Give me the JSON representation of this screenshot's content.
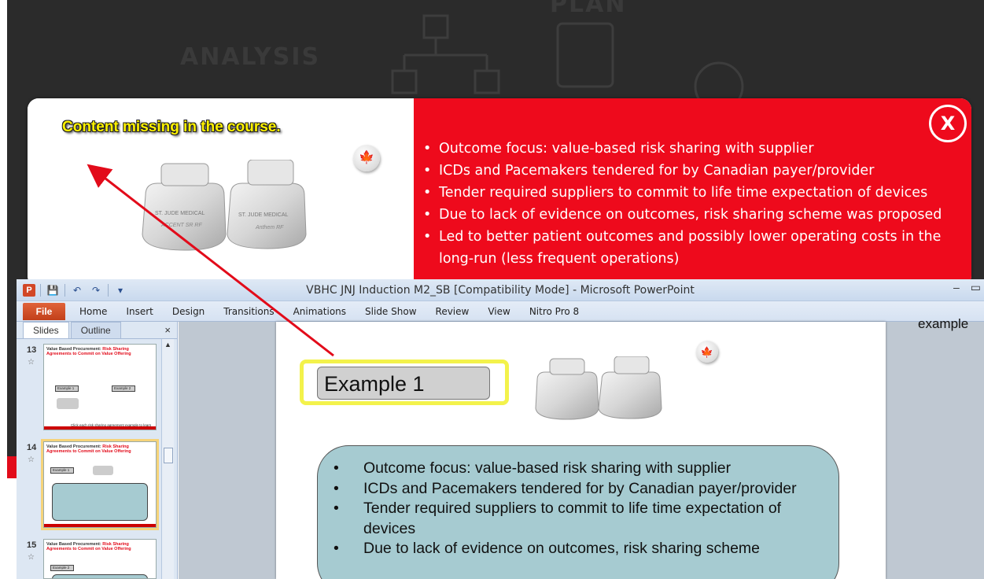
{
  "course": {
    "ghost_words": [
      "ANALYSIS",
      "PLAN"
    ],
    "popup": {
      "annotation_note": "Content missing in the course.",
      "bullets": [
        "Outcome focus: value-based risk sharing with supplier",
        "ICDs and Pacemakers tendered for by Canadian payer/provider",
        "Tender required suppliers to commit to life time expectation of devices",
        "Due to lack of evidence on outcomes, risk sharing scheme was proposed",
        "Led to better patient outcomes and possibly lower operating costs in the long-run (less frequent operations)"
      ],
      "close_label": "X",
      "device_labels": [
        "ST. JUDE MEDICAL",
        "ACCENT SR RF",
        "Anthem RF"
      ],
      "colors": {
        "accent_red": "#ee0a1c",
        "note_yellow": "#fff200",
        "arrow_red": "#e20b1a"
      }
    }
  },
  "ppt": {
    "window_title": "VBHC JNJ Induction M2_SB [Compatibility Mode]  -  Microsoft PowerPoint",
    "app_icon": "P",
    "qat_icons": [
      "save-icon",
      "undo-icon",
      "redo-icon",
      "customize-icon"
    ],
    "window_controls": [
      "–",
      "▭"
    ],
    "tabs": [
      "File",
      "Home",
      "Insert",
      "Design",
      "Transitions",
      "Animations",
      "Slide Show",
      "Review",
      "View",
      "Nitro Pro 8"
    ],
    "pane_tabs": [
      "Slides",
      "Outline"
    ],
    "pane_close": "×",
    "thumbnails": [
      {
        "number": "13",
        "title_prefix": "Value Based Procurement: ",
        "title_highlight": "Risk Sharing",
        "subtitle": "Agreements to Commit on Value Offering",
        "buttons": [
          "Example 1",
          "Example 2"
        ],
        "caption": "Click each risk sharing agreement example to learn more."
      },
      {
        "number": "14",
        "title_prefix": "Value Based Procurement: ",
        "title_highlight": "Risk Sharing",
        "subtitle": "Agreements to Commit on Value Offering",
        "buttons": [
          "Example 1"
        ],
        "caption": ""
      },
      {
        "number": "15",
        "title_prefix": "Value Based Procurement: ",
        "title_highlight": "Risk Sharing",
        "subtitle": "Agreements to Commit on Value Offering",
        "buttons": [
          "Example 2"
        ],
        "caption": ""
      }
    ],
    "slide": {
      "example_label": "Example 1",
      "bullets": [
        "Outcome focus: value-based risk sharing with supplier",
        "ICDs and Pacemakers tendered for by Canadian payer/provider",
        "Tender required suppliers to commit to life time expectation of devices",
        "Due to lack of evidence on outcomes, risk sharing scheme"
      ]
    },
    "side_text": "example"
  }
}
